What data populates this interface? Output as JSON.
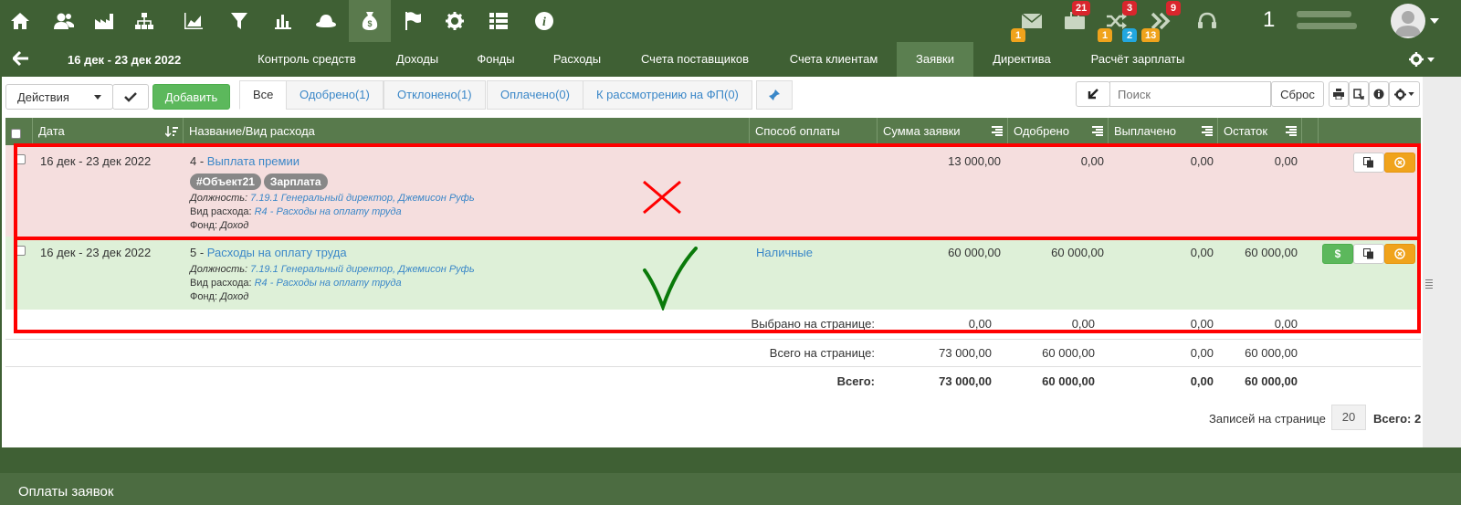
{
  "topnav": {
    "icons": [
      "home-icon",
      "users-icon",
      "factory-icon",
      "sitemap-icon",
      "area-chart-icon",
      "filter-icon",
      "bar-chart-icon",
      "hat-icon",
      "money-bag-icon",
      "flag-icon",
      "gear-icon",
      "list-icon",
      "info-icon"
    ],
    "active_icon": "money-bag-icon",
    "right": {
      "mail_badge_bottom": "1",
      "briefcase_badge_top": "21",
      "shuffle_badge_top": "3",
      "shuffle_badge_bottom_orange": "1",
      "shuffle_badge_bottom_blue": "2",
      "forward_badge_top": "9",
      "forward_badge_bottom": "13",
      "user_number": "1"
    }
  },
  "subnav": {
    "daterange": "16 дек - 23 дек 2022",
    "tabs": [
      "Контроль средств",
      "Доходы",
      "Фонды",
      "Расходы",
      "Счета поставщиков",
      "Счета клиентам",
      "Заявки",
      "Директива",
      "Расчёт зарплаты"
    ],
    "active_tab": "Заявки"
  },
  "toolbar": {
    "actions_label": "Действия",
    "add_label": "Добавить",
    "filter_tabs": [
      "Все",
      "Одобрено(1)",
      "Отклонено(1)",
      "Оплачено(0)",
      "К рассмотрению на ФП(0)"
    ],
    "search_placeholder": "Поиск",
    "reset_label": "Сброс"
  },
  "table": {
    "headers": {
      "date": "Дата",
      "name": "Название/Вид расхода",
      "payment": "Способ оплаты",
      "sum": "Сумма заявки",
      "approved": "Одобрено",
      "paid": "Выплачено",
      "remainder": "Остаток"
    },
    "rows": [
      {
        "date": "16 дек - 23 дек 2022",
        "num": "4 - ",
        "title": "Выплата премии",
        "tags": [
          "#Объект21",
          "Зарплата"
        ],
        "position_label": "Должность:",
        "position": "7.19.1 Генеральный директор, Джемисон Руфь",
        "expense_label": "Вид расхода:",
        "expense": "R4 - Расходы на оплату труда",
        "fund_label": "Фонд:",
        "fund": "Доход",
        "payment": "",
        "sum": "13 000,00",
        "approved": "0,00",
        "paid": "0,00",
        "remainder": "0,00"
      },
      {
        "date": "16 дек - 23 дек 2022",
        "num": "5 - ",
        "title": "Расходы на оплату труда",
        "position_label": "Должность:",
        "position": "7.19.1 Генеральный директор, Джемисон Руфь",
        "expense_label": "Вид расхода:",
        "expense": "R4 - Расходы на оплату труда",
        "fund_label": "Фонд:",
        "fund": "Доход",
        "payment": "Наличные",
        "pay_button": "$",
        "sum": "60 000,00",
        "approved": "60 000,00",
        "paid": "0,00",
        "remainder": "60 000,00"
      }
    ],
    "selected": {
      "label": "Выбрано на странице:",
      "sum": "0,00",
      "approved": "0,00",
      "paid": "0,00",
      "remainder": "0,00"
    },
    "page_total": {
      "label": "Всего на странице:",
      "sum": "73 000,00",
      "approved": "60 000,00",
      "paid": "0,00",
      "remainder": "60 000,00"
    },
    "grand_total": {
      "label": "Всего:",
      "sum": "73 000,00",
      "approved": "60 000,00",
      "paid": "0,00",
      "remainder": "60 000,00"
    }
  },
  "pager": {
    "label": "Записей на странице",
    "per_page": "20",
    "total": "Всего: 2"
  },
  "bottom": {
    "title": "Оплаты заявок"
  },
  "colors": {
    "topbar": "#3f6034",
    "header": "#587a4c",
    "row_rejected": "#f5dede",
    "row_approved": "#def0d8",
    "annotation": "#ff0000"
  }
}
